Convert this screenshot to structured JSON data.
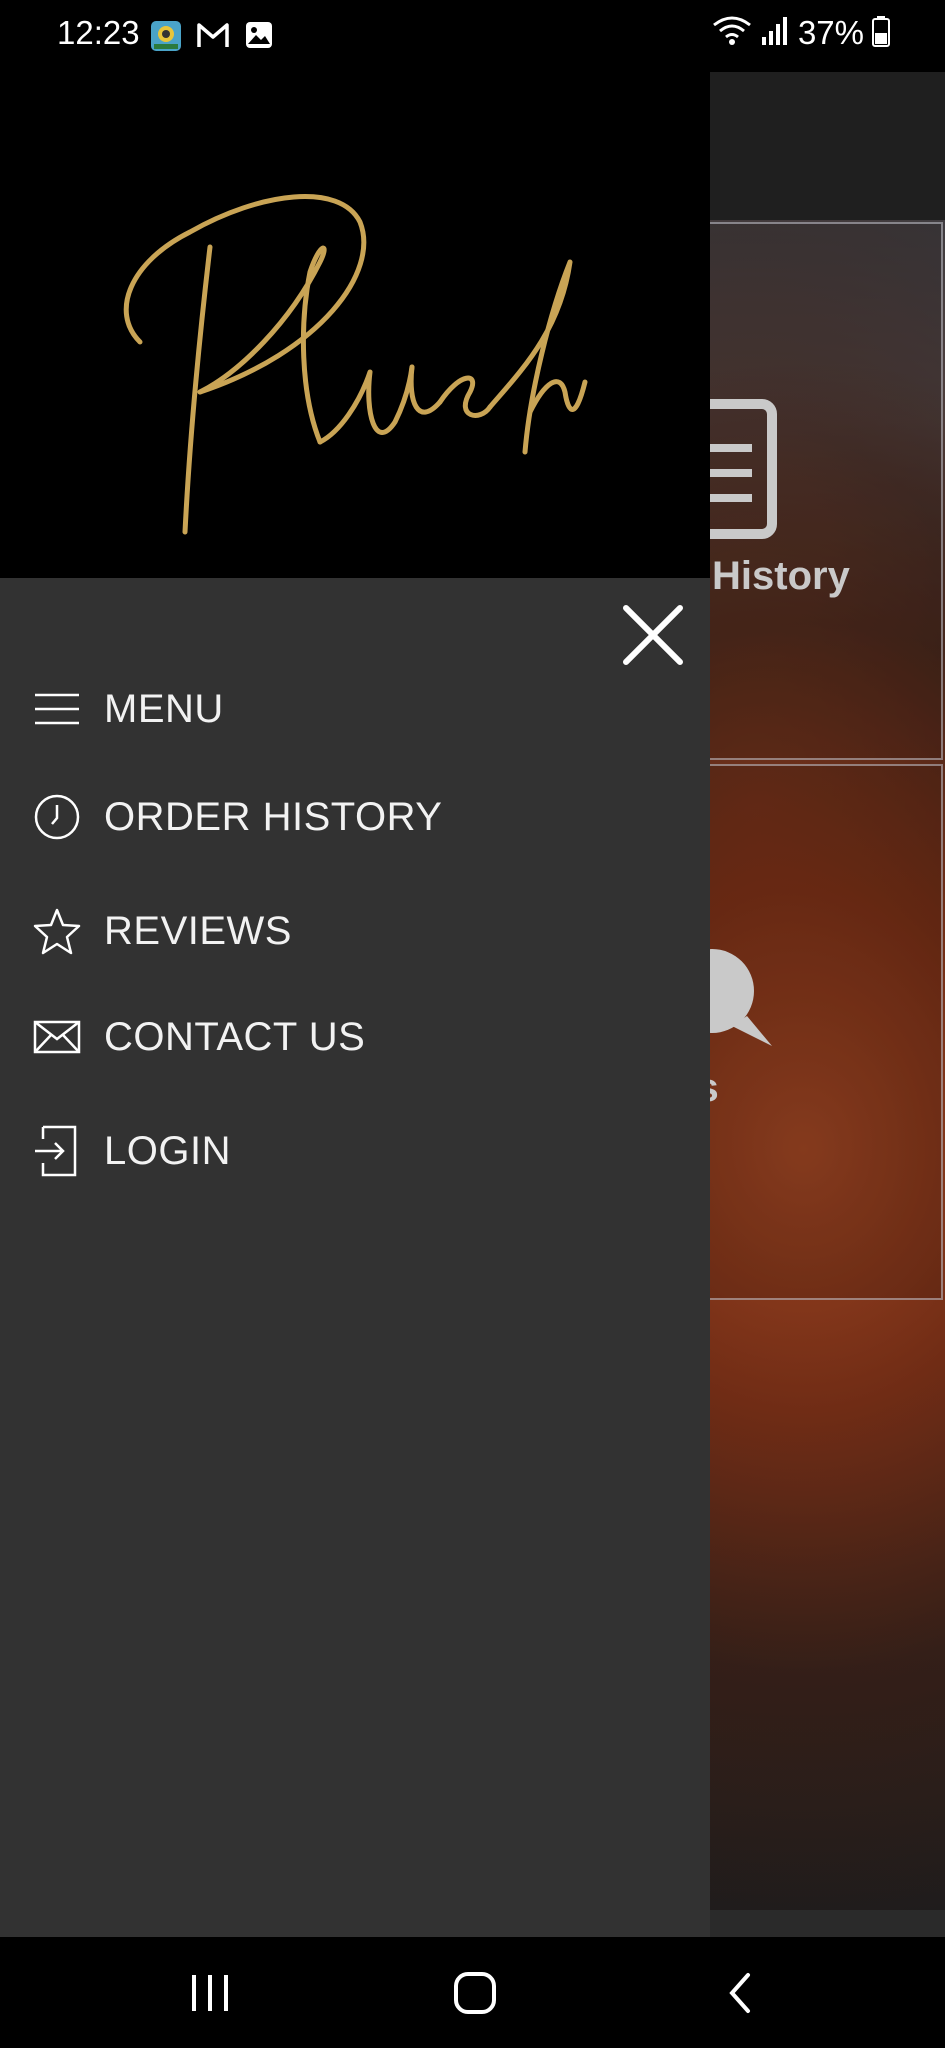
{
  "status_bar": {
    "time": "12:23",
    "battery": "37%"
  },
  "background_app": {
    "tile_1_label": "History",
    "tile_2_label": "iews"
  },
  "drawer": {
    "logo_text": "Plush",
    "items": [
      {
        "label": "MENU",
        "icon": "hamburger-icon"
      },
      {
        "label": "ORDER HISTORY",
        "icon": "clock-icon"
      },
      {
        "label": "REVIEWS",
        "icon": "star-icon"
      },
      {
        "label": "CONTACT US",
        "icon": "envelope-icon"
      },
      {
        "label": "LOGIN",
        "icon": "login-icon"
      }
    ]
  },
  "colors": {
    "logo_gold": "#c9a455",
    "drawer_bg": "#323232",
    "text": "#f2f2f2"
  }
}
